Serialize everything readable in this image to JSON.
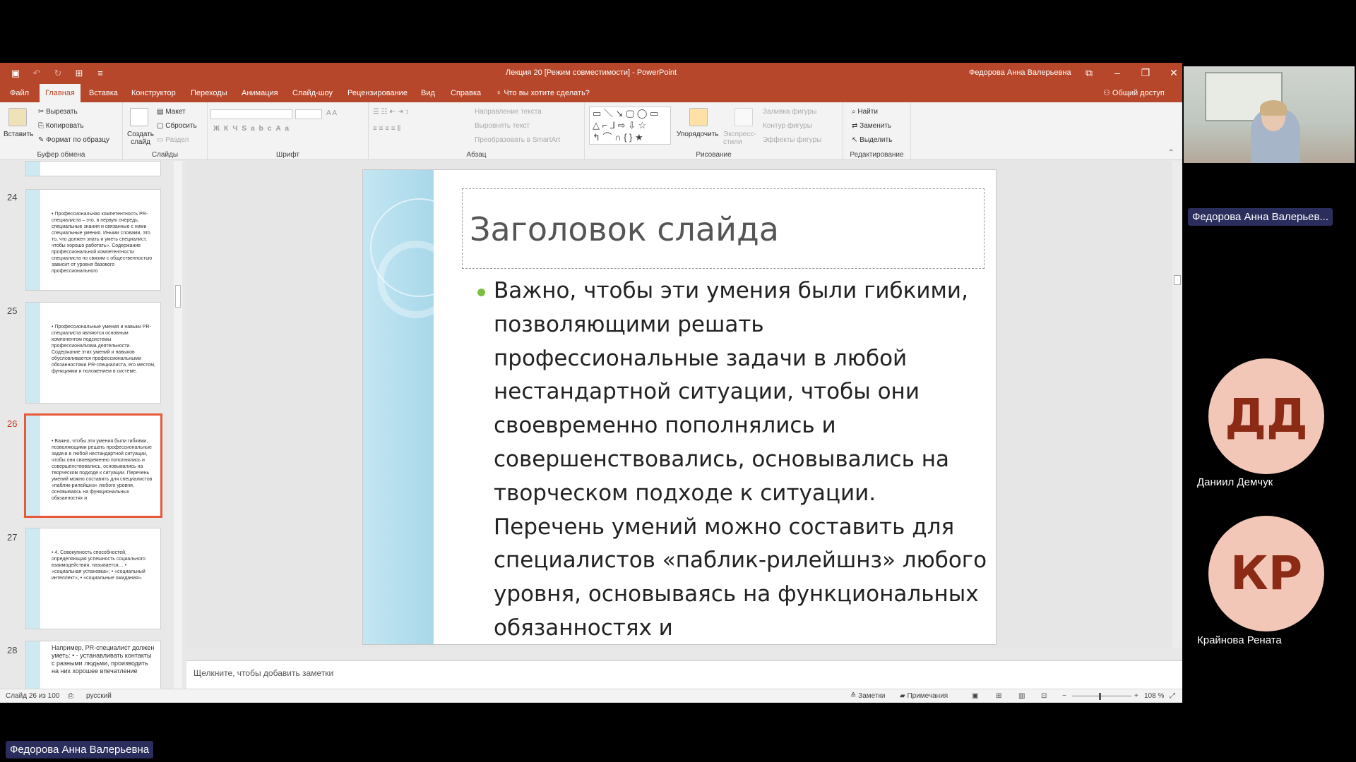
{
  "window": {
    "title": "Лекция 20 [Режим совместимости]  -  PowerPoint",
    "user": "Федорова Анна Валерьевна",
    "qat_icons": [
      "save-icon",
      "undo-icon",
      "redo-icon",
      "start-presentation-icon",
      "customize-qat-icon"
    ]
  },
  "tabs": {
    "items": [
      "Файл",
      "Главная",
      "Вставка",
      "Конструктор",
      "Переходы",
      "Анимация",
      "Слайд-шоу",
      "Рецензирование",
      "Вид",
      "Справка"
    ],
    "active": "Главная",
    "tell_me": "Что вы хотите сделать?",
    "share": "Общий доступ"
  },
  "ribbon": {
    "clipboard": {
      "paste": "Вставить",
      "cut": "Вырезать",
      "copy": "Копировать",
      "format_painter": "Формат по образцу",
      "label": "Буфер обмена"
    },
    "slides": {
      "new_slide": "Создать слайд",
      "layout": "Макет",
      "reset": "Сбросить",
      "section": "Раздел",
      "label": "Слайды"
    },
    "font": {
      "label": "Шрифт"
    },
    "paragraph": {
      "text_direction": "Направление текста",
      "align_text": "Выровнять текст",
      "smartart": "Преобразовать в SmartArt",
      "label": "Абзац"
    },
    "drawing": {
      "arrange": "Упорядочить",
      "quick_styles": "Экспресс-стили",
      "shape_fill": "Заливка фигуры",
      "shape_outline": "Контур фигуры",
      "shape_effects": "Эффекты фигуры",
      "label": "Рисование"
    },
    "editing": {
      "find": "Найти",
      "replace": "Заменить",
      "select": "Выделить",
      "label": "Редактирование"
    }
  },
  "thumbnails": [
    {
      "num": "24",
      "text": "• Профессиональная компетентность PR-специалиста – это, в первую очередь, специальные знания и связанные с ними специальные умения. Иными словами, это то, что должен знать и уметь специалист, чтобы хорошо работать». Содержание профессиональной компетентности специалиста по связям с общественностью зависит от уровня базового профессионального"
    },
    {
      "num": "25",
      "text": "• Профессиональные умения и навыки PR-специалиста являются основным компонентом подсистемы профессионализма деятельности. Содержание этих умений и навыков обусловливается профессиональными обязанностями PR-специалиста, его местом, функциями и положением в системе."
    },
    {
      "num": "26",
      "text": "• Важно, чтобы эти умения были гибкими, позволяющими решать профессиональные задачи в любой нестандартной ситуации, чтобы они своевременно пополнялись и совершенствовались, основывались на творческом подходе к ситуации. Перечень умений можно составить для специалистов «паблик-рилейшнз» любого уровня, основываясь на функциональных обязанностях и"
    },
    {
      "num": "27",
      "text": "• 4. Совокупность способностей, определяющая успешность социального взаимодействия, называется… • «социальная установка»; • «социальный интеллект»; • «социальные ожидания»."
    },
    {
      "num": "28",
      "text": "Например, PR-специалист должен уметь: • - устанавливать контакты с разными людьми, производить на них хорошее впечатление"
    }
  ],
  "slide": {
    "title": "Заголовок слайда",
    "body": "Важно, чтобы эти умения были гибкими, позволяющими решать профессиональные задачи в любой нестандартной ситуации, чтобы они своевременно пополнялись и совершенствовались, основывались на творческом подходе к ситуации. Перечень умений можно составить для специалистов «паблик-рилейшнз» любого уровня, основываясь на функциональных обязанностях и",
    "bullet_color": "#7ac143"
  },
  "notes_placeholder": "Щелкните, чтобы добавить заметки",
  "status": {
    "slide_counter": "Слайд 26 из 100",
    "language": "русский",
    "notes": "Заметки",
    "comments": "Примечания",
    "zoom": "108 %"
  },
  "participants": {
    "presenter_label": "Федорова Анна Валерьев...",
    "people": [
      {
        "initials": "ДД",
        "name": "Даниил Демчук"
      },
      {
        "initials": "КР",
        "name": "Крайнова Рената"
      }
    ],
    "bottom_label": "Федорова Анна Валерьевна"
  },
  "colors": {
    "ppt_accent": "#b7472a",
    "avatar_bg": "#f2c7b8",
    "avatar_fg": "#8b2b16",
    "badge_bg": "#2b2d5c"
  }
}
